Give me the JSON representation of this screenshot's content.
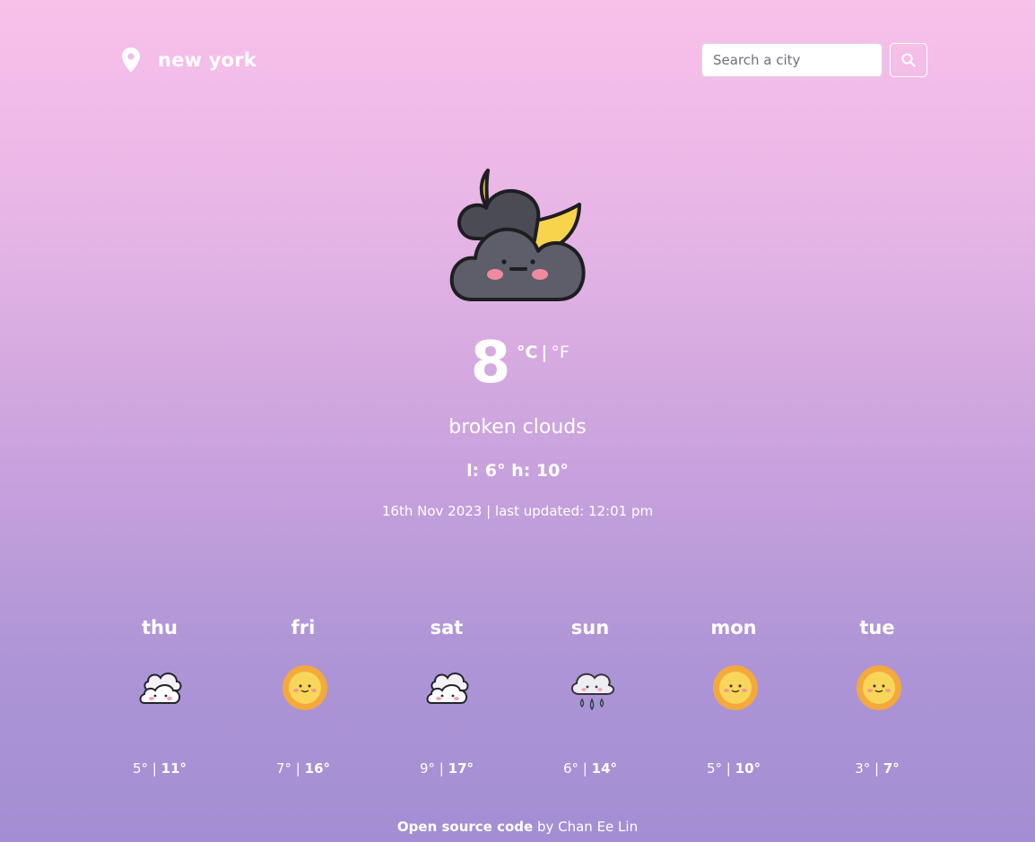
{
  "header": {
    "location_icon": "map-pin-icon",
    "city": "new york",
    "search_placeholder": "Search a city",
    "search_icon": "search-icon"
  },
  "current": {
    "icon": "night-broken-clouds-moon-icon",
    "temperature": "8",
    "unit_c": "°C",
    "unit_sep": "|",
    "unit_f": "°F",
    "description": "broken clouds",
    "low_high": "l: 6° h: 10°",
    "date_updated": "16th Nov 2023 | last updated: 12:01 pm"
  },
  "forecast": [
    {
      "day": "thu",
      "icon": "clouds-icon",
      "low": "5°",
      "sep": "|",
      "high": "11°"
    },
    {
      "day": "fri",
      "icon": "sun-icon",
      "low": "7°",
      "sep": "|",
      "high": "16°"
    },
    {
      "day": "sat",
      "icon": "clouds-icon",
      "low": "9°",
      "sep": "|",
      "high": "17°"
    },
    {
      "day": "sun",
      "icon": "rain-cloud-icon",
      "low": "6°",
      "sep": "|",
      "high": "14°"
    },
    {
      "day": "mon",
      "icon": "sun-icon",
      "low": "5°",
      "sep": "|",
      "high": "10°"
    },
    {
      "day": "tue",
      "icon": "sun-icon",
      "low": "3°",
      "sep": "|",
      "high": "7°"
    }
  ],
  "footer": {
    "link_text": "Open source code",
    "by_text": "by Chan Ee Lin"
  },
  "colors": {
    "gradient_top": "#f8c1ea",
    "gradient_bottom": "#a48ed3",
    "text": "#ffffff"
  }
}
